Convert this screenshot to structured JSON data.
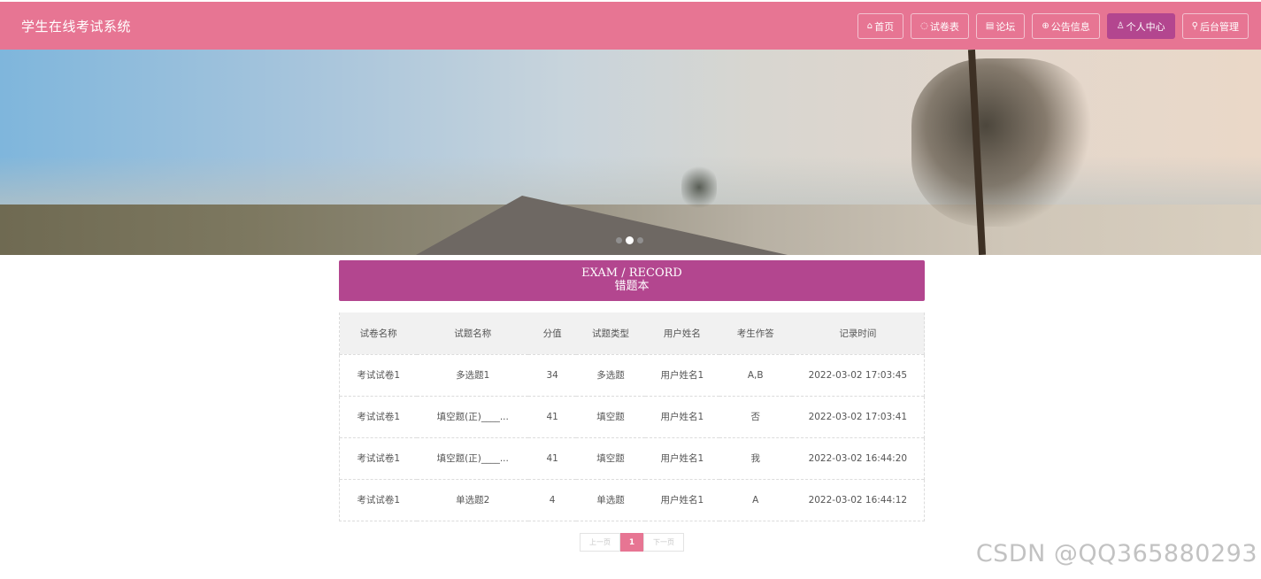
{
  "header": {
    "brand": "学生在线考试系统",
    "nav": [
      {
        "label": "首页",
        "icon": "⌂",
        "icon_name": "home-icon"
      },
      {
        "label": "试卷表",
        "icon": "◌",
        "icon_name": "paper-icon"
      },
      {
        "label": "论坛",
        "icon": "▤",
        "icon_name": "forum-icon"
      },
      {
        "label": "公告信息",
        "icon": "⊕",
        "icon_name": "notice-icon"
      },
      {
        "label": "个人中心",
        "icon": "♙",
        "icon_name": "user-icon"
      },
      {
        "label": "后台管理",
        "icon": "⚲",
        "icon_name": "link-icon"
      }
    ],
    "active_nav": "个人中心"
  },
  "banner": {
    "slides": 3,
    "active_slide": 2
  },
  "section": {
    "title_en": "EXAM / RECORD",
    "title_cn": "错题本"
  },
  "table": {
    "headers": [
      "试卷名称",
      "试题名称",
      "分值",
      "试题类型",
      "用户姓名",
      "考生作答",
      "记录时间"
    ],
    "rows": [
      [
        "考试试卷1",
        "多选题1",
        "34",
        "多选题",
        "用户姓名1",
        "A,B",
        "2022-03-02 17:03:45"
      ],
      [
        "考试试卷1",
        "填空题(正)____...",
        "41",
        "填空题",
        "用户姓名1",
        "否",
        "2022-03-02 17:03:41"
      ],
      [
        "考试试卷1",
        "填空题(正)____...",
        "41",
        "填空题",
        "用户姓名1",
        "我",
        "2022-03-02 16:44:20"
      ],
      [
        "考试试卷1",
        "单选题2",
        "4",
        "单选题",
        "用户姓名1",
        "A",
        "2022-03-02 16:44:12"
      ]
    ]
  },
  "pagination": {
    "prev": "上一页",
    "current": "1",
    "next": "下一页"
  },
  "watermark": "CSDN @QQ365880293",
  "colors": {
    "header": "#e77593",
    "accent": "#b3468f"
  }
}
